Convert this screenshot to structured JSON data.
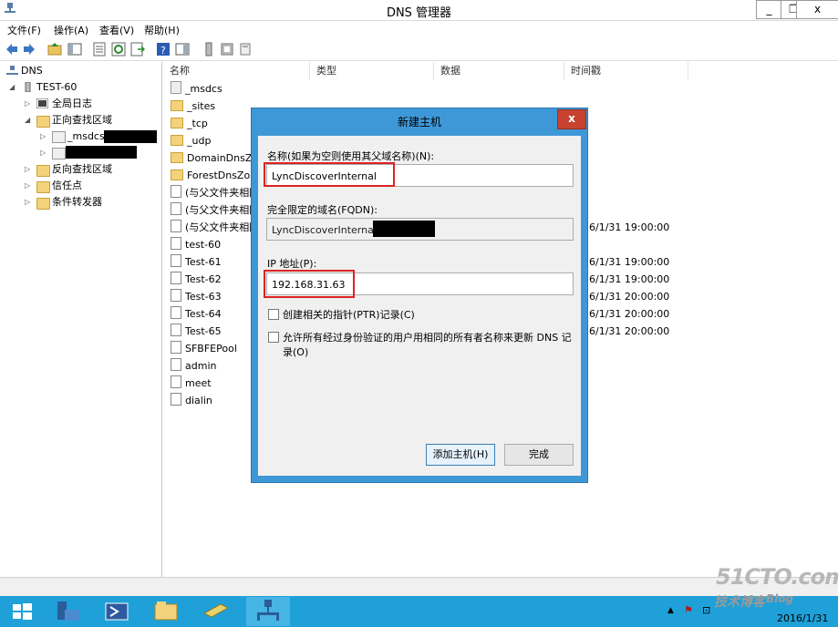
{
  "window": {
    "title": "DNS 管理器",
    "controls": [
      "_",
      "❐",
      "x"
    ]
  },
  "menu": [
    "文件(F)",
    "操作(A)",
    "查看(V)",
    "帮助(H)"
  ],
  "tree": {
    "root": "DNS",
    "server": "TEST-60",
    "items": [
      "全局日志",
      "正向查找区域",
      "_msdcs",
      "反向查找区域",
      "信任点",
      "条件转发器"
    ]
  },
  "list": {
    "columns": [
      "名称",
      "类型",
      "数据",
      "时间戳"
    ],
    "rows": [
      {
        "name": "_msdcs",
        "icon": "zone",
        "timestamp": ""
      },
      {
        "name": "_sites",
        "icon": "folder",
        "timestamp": ""
      },
      {
        "name": "_tcp",
        "icon": "folder",
        "timestamp": ""
      },
      {
        "name": "_udp",
        "icon": "folder",
        "timestamp": ""
      },
      {
        "name": "DomainDnsZo",
        "icon": "folder",
        "timestamp": ""
      },
      {
        "name": "ForestDnsZone",
        "icon": "folder",
        "timestamp": ""
      },
      {
        "name": "(与父文件夹相同",
        "icon": "record",
        "timestamp": ""
      },
      {
        "name": "(与父文件夹相同",
        "icon": "record",
        "timestamp": ""
      },
      {
        "name": "(与父文件夹相同",
        "icon": "record",
        "timestamp": "6/1/31 19:00:00"
      },
      {
        "name": "test-60",
        "icon": "record",
        "timestamp": ""
      },
      {
        "name": "Test-61",
        "icon": "record",
        "timestamp": "6/1/31 19:00:00"
      },
      {
        "name": "Test-62",
        "icon": "record",
        "timestamp": "6/1/31 19:00:00"
      },
      {
        "name": "Test-63",
        "icon": "record",
        "timestamp": "6/1/31 20:00:00"
      },
      {
        "name": "Test-64",
        "icon": "record",
        "timestamp": "6/1/31 20:00:00"
      },
      {
        "name": "Test-65",
        "icon": "record",
        "timestamp": "6/1/31 20:00:00"
      },
      {
        "name": "SFBFEPool",
        "icon": "record",
        "timestamp": ""
      },
      {
        "name": "admin",
        "icon": "record",
        "timestamp": ""
      },
      {
        "name": "meet",
        "icon": "record",
        "timestamp": ""
      },
      {
        "name": "dialin",
        "icon": "record",
        "timestamp": ""
      }
    ]
  },
  "dialog": {
    "title": "新建主机",
    "close": "x",
    "name_label": "名称(如果为空则使用其父域名称)(N):",
    "name_value": "LyncDiscoverInternal",
    "fqdn_label": "完全限定的域名(FQDN):",
    "fqdn_value": "LyncDiscoverInterna",
    "ip_label": "IP 地址(P):",
    "ip_value": "192.168.31.63",
    "ptr_label": "创建相关的指针(PTR)记录(C)",
    "allow_label_1": "允许所有经过身份验证的用户用相同的所有者名称来更新 DNS 记",
    "allow_label_2": "录(O)",
    "add_button": "添加主机(H)",
    "done_button": "完成"
  },
  "taskbar": {
    "clock": "2016/1/31"
  },
  "watermark": {
    "line1": "51CTO.com",
    "line2": "技术博客",
    "line3": "Blog"
  },
  "colors": {
    "taskbar": "#1fa0d8",
    "dialog_frame": "#3e98d8",
    "close_button": "#c7432f",
    "highlight": "#dd2222"
  }
}
